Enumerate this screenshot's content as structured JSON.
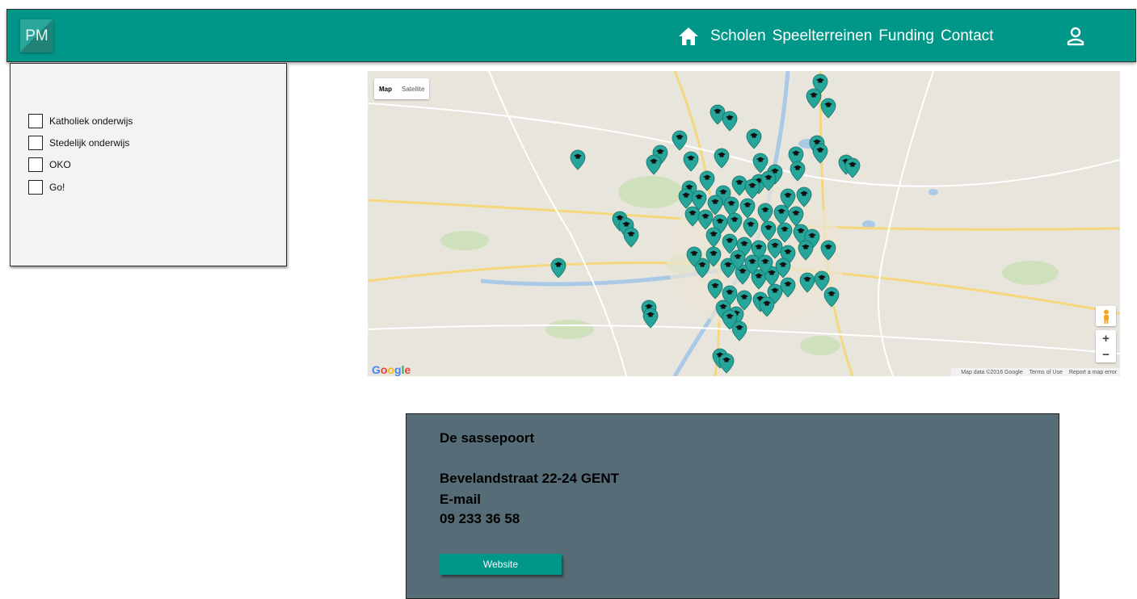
{
  "header": {
    "logo": "PM",
    "nav": [
      "Scholen",
      "Speelterreinen",
      "Funding",
      "Contact"
    ],
    "icons": [
      "home-icon",
      "user-icon"
    ],
    "background_color": "#009688"
  },
  "filters": [
    {
      "label": "Katholiek onderwijs",
      "checked": false
    },
    {
      "label": "Stedelijk onderwijs",
      "checked": false
    },
    {
      "label": "OKO",
      "checked": false
    },
    {
      "label": "Go!",
      "checked": false
    }
  ],
  "map": {
    "type_buttons": [
      "Map",
      "Satellite"
    ],
    "active_type": "Map",
    "zoom_in": "+",
    "zoom_out": "−",
    "marker_icon": "graduation-cap-marker",
    "marker_color": "#26a69a",
    "google_logo": "Google",
    "footer": [
      "Map data ©2016 Google",
      "Terms of Use",
      "Report a map error"
    ]
  },
  "school": {
    "name": "De sassepoort",
    "address": "Bevelandstraat 22-24 GENT",
    "email_label": "E-mail",
    "phone": "09 233 36 58",
    "website_button": "Website",
    "card_color": "#566d78"
  }
}
